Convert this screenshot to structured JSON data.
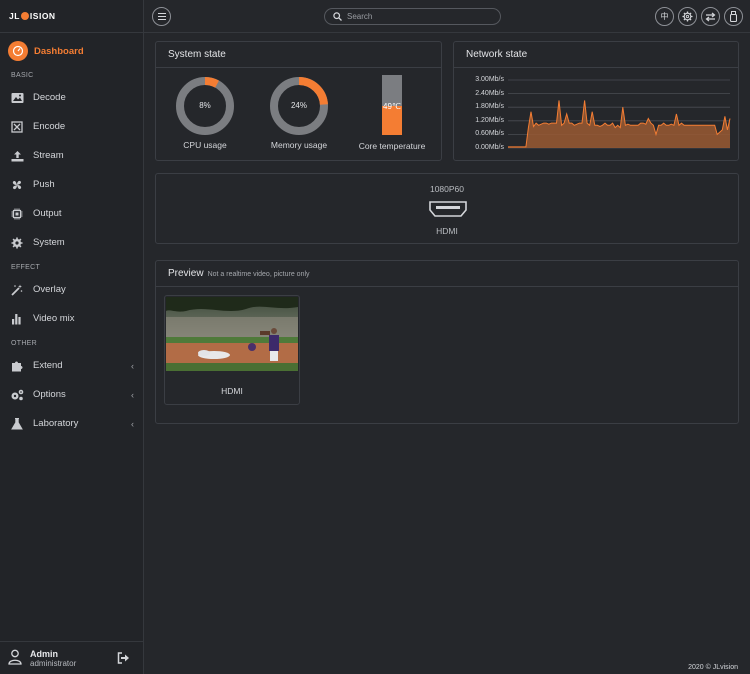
{
  "brand": {
    "logo_left": "JL",
    "logo_right": "ISION",
    "accent": "#f47d33"
  },
  "nav": {
    "dashboard": "Dashboard",
    "sections": {
      "basic": "BASIC",
      "effect": "EFFECT",
      "other": "OTHER"
    },
    "basic": [
      {
        "label": "Decode",
        "icon": "image-icon"
      },
      {
        "label": "Encode",
        "icon": "encode-icon"
      },
      {
        "label": "Stream",
        "icon": "upload-icon"
      },
      {
        "label": "Push",
        "icon": "fan-icon"
      },
      {
        "label": "Output",
        "icon": "chip-icon"
      },
      {
        "label": "System",
        "icon": "gear-icon"
      }
    ],
    "effect": [
      {
        "label": "Overlay",
        "icon": "magic-wand-icon"
      },
      {
        "label": "Video mix",
        "icon": "bar-chart-icon"
      }
    ],
    "other": [
      {
        "label": "Extend",
        "icon": "puzzle-icon"
      },
      {
        "label": "Options",
        "icon": "cogs-icon"
      },
      {
        "label": "Laboratory",
        "icon": "flask-icon"
      }
    ]
  },
  "user": {
    "name": "Admin",
    "role": "administrator"
  },
  "topbar": {
    "search_placeholder": "Search",
    "lang": "中"
  },
  "system_state": {
    "title": "System state",
    "cpu": {
      "value": "8%",
      "fraction": 0.08,
      "label": "CPU usage"
    },
    "memory": {
      "value": "24%",
      "fraction": 0.24,
      "label": "Memory usage"
    },
    "temperature": {
      "value": "49℃",
      "fraction": 0.49,
      "label": "Core temperature"
    }
  },
  "network_state": {
    "title": "Network state",
    "ticks": [
      "3.00Mb/s",
      "2.40Mb/s",
      "1.80Mb/s",
      "1.20Mb/s",
      "0.60Mb/s",
      "0.00Mb/s"
    ],
    "ymax": 3.0,
    "series": [
      0.05,
      0.05,
      0.05,
      0.05,
      0.05,
      0.05,
      0.05,
      0.05,
      0.9,
      1.6,
      0.95,
      1.1,
      1.0,
      1.05,
      1.1,
      1.1,
      1.05,
      1.1,
      1.1,
      1.1,
      2.1,
      1.0,
      1.1,
      1.5,
      1.1,
      1.1,
      1.0,
      1.05,
      1.1,
      1.1,
      2.1,
      1.1,
      1.0,
      1.6,
      1.0,
      1.0,
      0.95,
      1.0,
      1.1,
      1.0,
      1.0,
      1.1,
      0.9,
      1.0,
      0.9,
      1.8,
      1.0,
      1.05,
      1.0,
      1.0,
      1.0,
      1.0,
      1.1,
      1.1,
      1.05,
      1.3,
      1.1,
      1.0,
      0.6,
      1.0,
      1.0,
      1.1,
      1.0,
      1.0,
      1.05,
      1.0,
      1.5,
      1.0,
      1.1,
      1.0,
      1.0,
      1.0,
      1.0,
      1.0,
      1.0,
      1.0,
      1.0,
      1.0,
      1.0,
      1.0,
      1.0,
      1.0,
      0.6,
      0.7,
      0.8,
      1.4,
      0.8,
      1.3
    ]
  },
  "output": {
    "resolution": "1080P60",
    "port": "HDMI"
  },
  "preview": {
    "title": "Preview",
    "subtitle": "Not a realtime video, picture only",
    "source_label": "HDMI"
  },
  "footer": "2020 © JLvision"
}
